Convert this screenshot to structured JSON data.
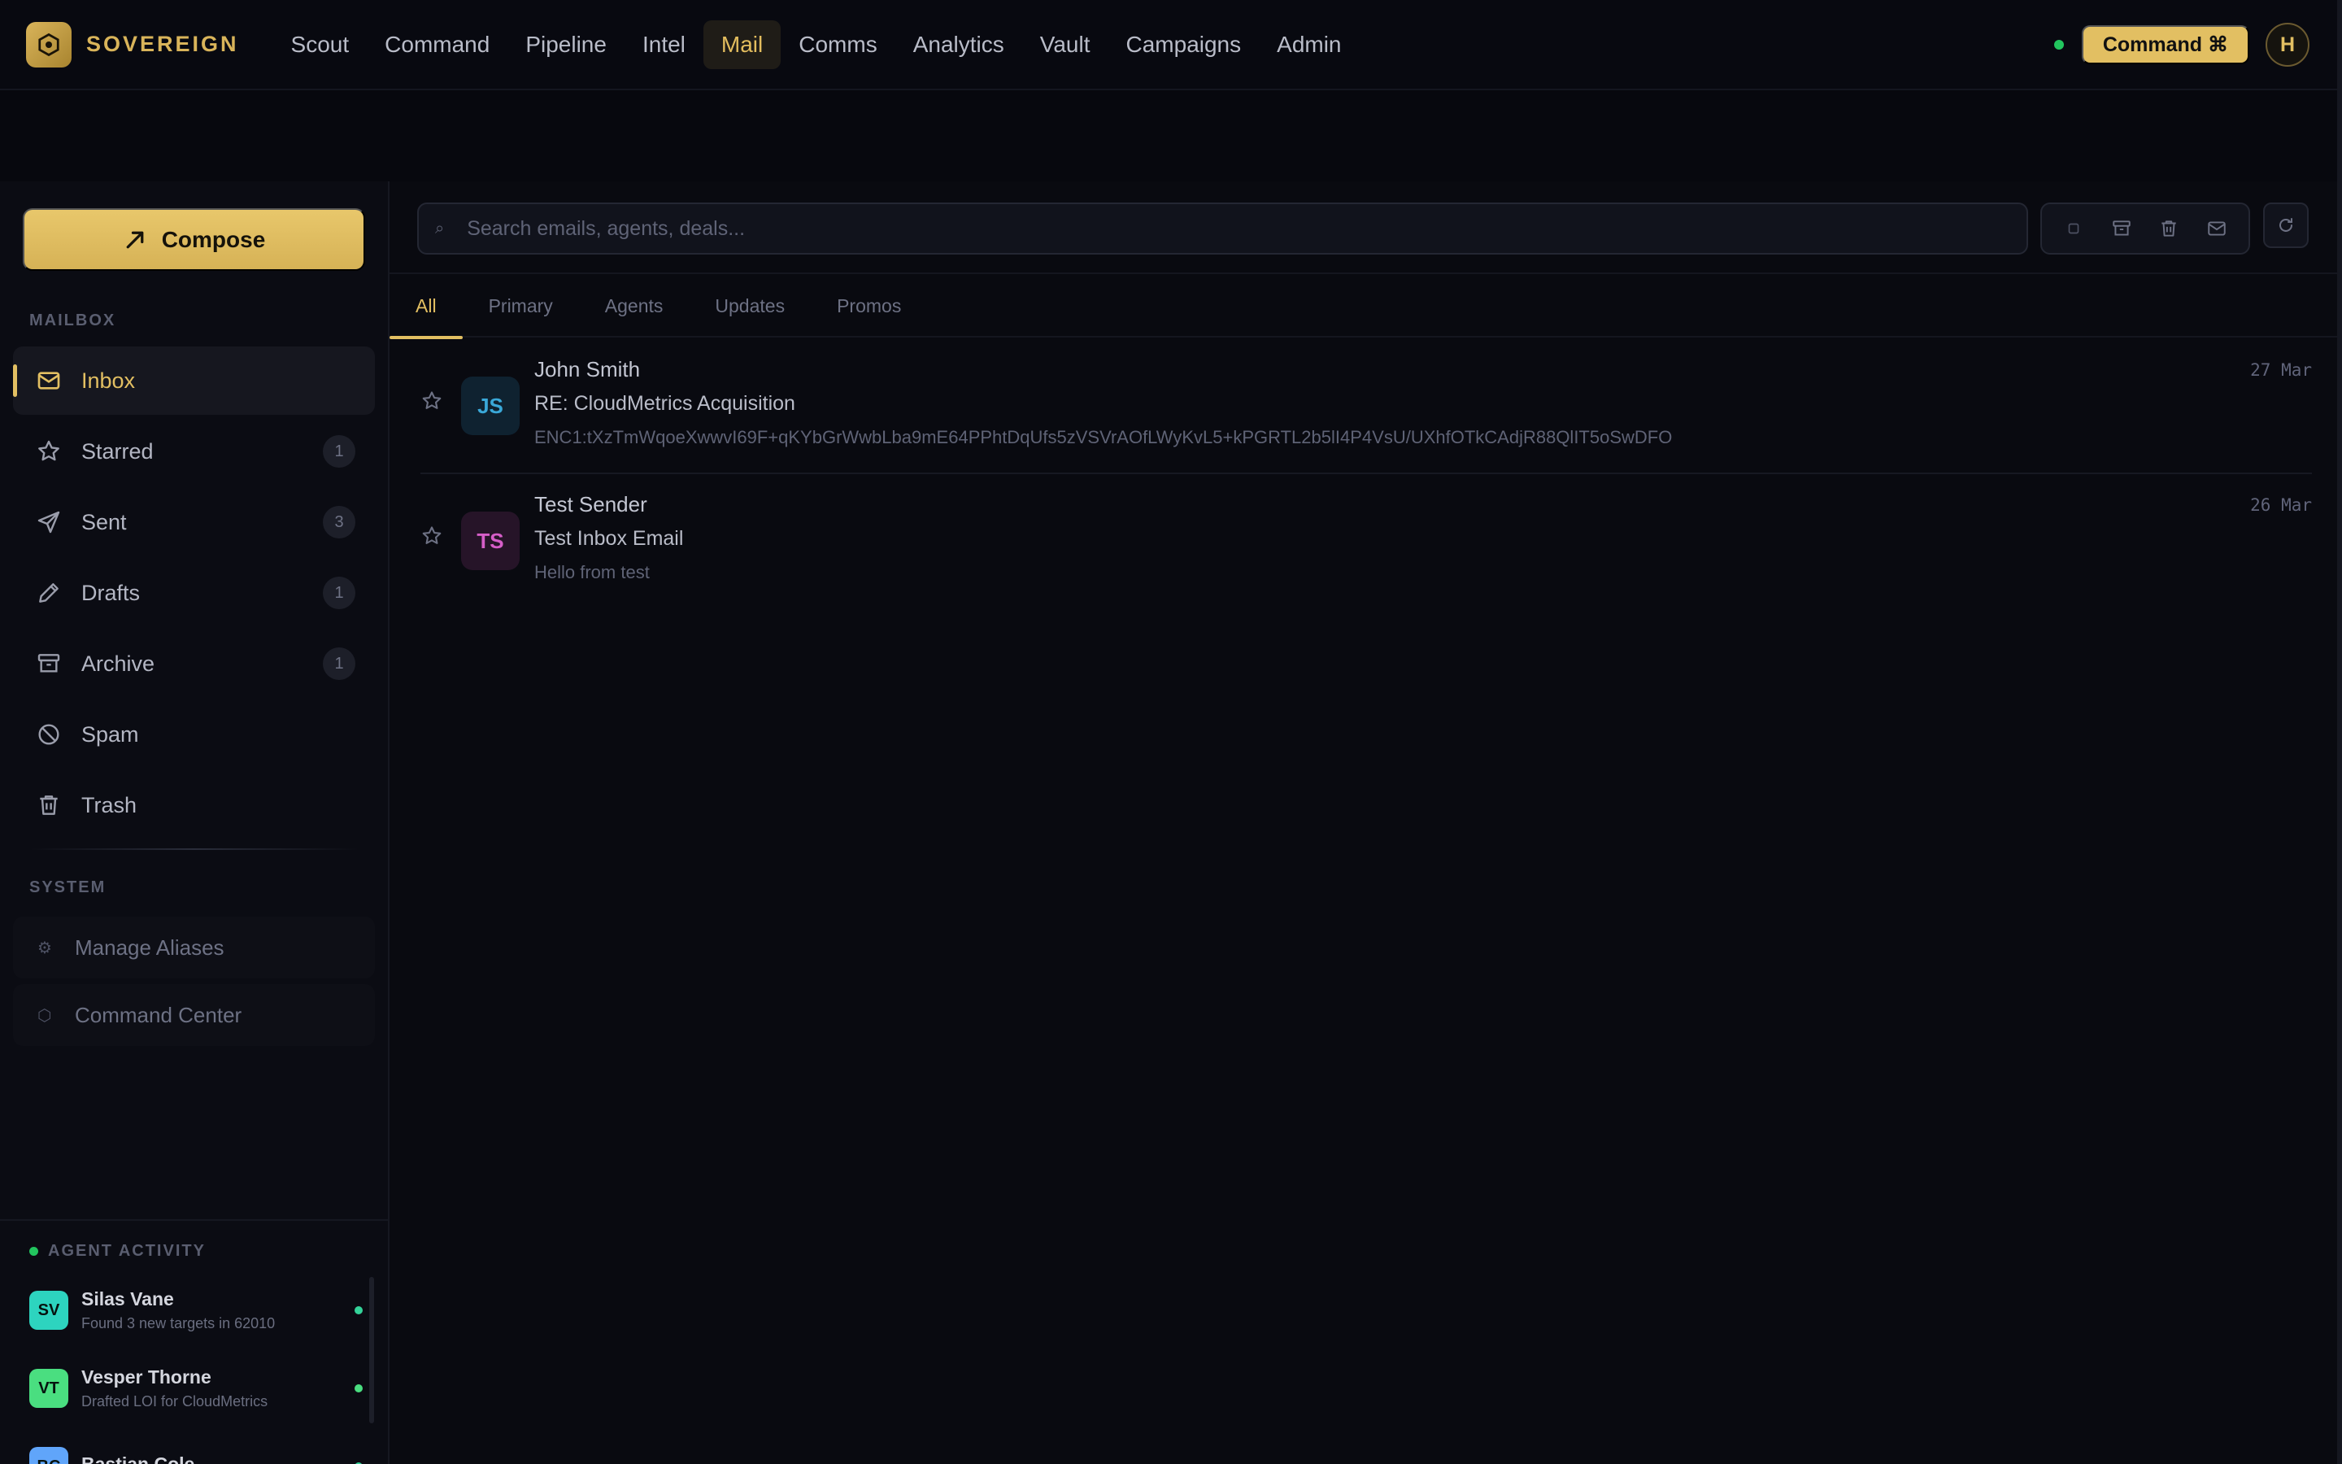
{
  "brand": {
    "name": "SOVEREIGN"
  },
  "nav": {
    "items": [
      "Scout",
      "Command",
      "Pipeline",
      "Intel",
      "Mail",
      "Comms",
      "Analytics",
      "Vault",
      "Campaigns",
      "Admin"
    ],
    "active": "Mail"
  },
  "header": {
    "command_label": "Command ⌘",
    "avatar_initial": "H"
  },
  "sidebar": {
    "compose_label": "Compose",
    "mailbox_label": "MAILBOX",
    "items": [
      {
        "label": "Inbox",
        "icon": "inbox-icon",
        "count": ""
      },
      {
        "label": "Starred",
        "icon": "star-icon",
        "count": "1"
      },
      {
        "label": "Sent",
        "icon": "send-icon",
        "count": "3"
      },
      {
        "label": "Drafts",
        "icon": "pencil-icon",
        "count": "1"
      },
      {
        "label": "Archive",
        "icon": "archive-icon",
        "count": "1"
      },
      {
        "label": "Spam",
        "icon": "ban-icon",
        "count": ""
      },
      {
        "label": "Trash",
        "icon": "trash-icon",
        "count": ""
      }
    ],
    "system_label": "SYSTEM",
    "system_items": [
      {
        "label": "Manage Aliases",
        "glyph": "⚙"
      },
      {
        "label": "Command Center",
        "glyph": "⬡"
      }
    ],
    "agent_activity_label": "AGENT ACTIVITY",
    "agents": [
      {
        "initials": "SV",
        "name": "Silas Vane",
        "activity": "Found 3 new targets in 62010",
        "color": "#2dd4bf"
      },
      {
        "initials": "VT",
        "name": "Vesper Thorne",
        "activity": "Drafted LOI for CloudMetrics",
        "color": "#4ade80"
      },
      {
        "initials": "BC",
        "name": "Bastian Cole",
        "activity": "",
        "color": "#60a5fa"
      }
    ]
  },
  "main": {
    "search_placeholder": "Search emails, agents, deals...",
    "tabs": [
      "All",
      "Primary",
      "Agents",
      "Updates",
      "Promos"
    ],
    "active_tab": "All",
    "emails": [
      {
        "initials": "JS",
        "from": "John Smith",
        "subject": "RE: CloudMetrics Acquisition",
        "preview": "ENC1:tXzTmWqoeXwwvI69F+qKYbGrWwbLba9mE64PPhtDqUfs5zVSVrAOfLWyKvL5+kPGRTL2b5lI4P4VsU/UXhfOTkCAdjR88QlIT5oSwDFO",
        "date": "27 Mar",
        "avatar_bg": "#0f2230",
        "avatar_fg": "#3aa8d8"
      },
      {
        "initials": "TS",
        "from": "Test Sender",
        "subject": "Test Inbox Email",
        "preview": "Hello from test",
        "date": "26 Mar",
        "avatar_bg": "#261428",
        "avatar_fg": "#d65ec8"
      }
    ]
  },
  "colors": {
    "accent": "#e2bf62",
    "online": "#22c55e",
    "background": "#07080e"
  }
}
